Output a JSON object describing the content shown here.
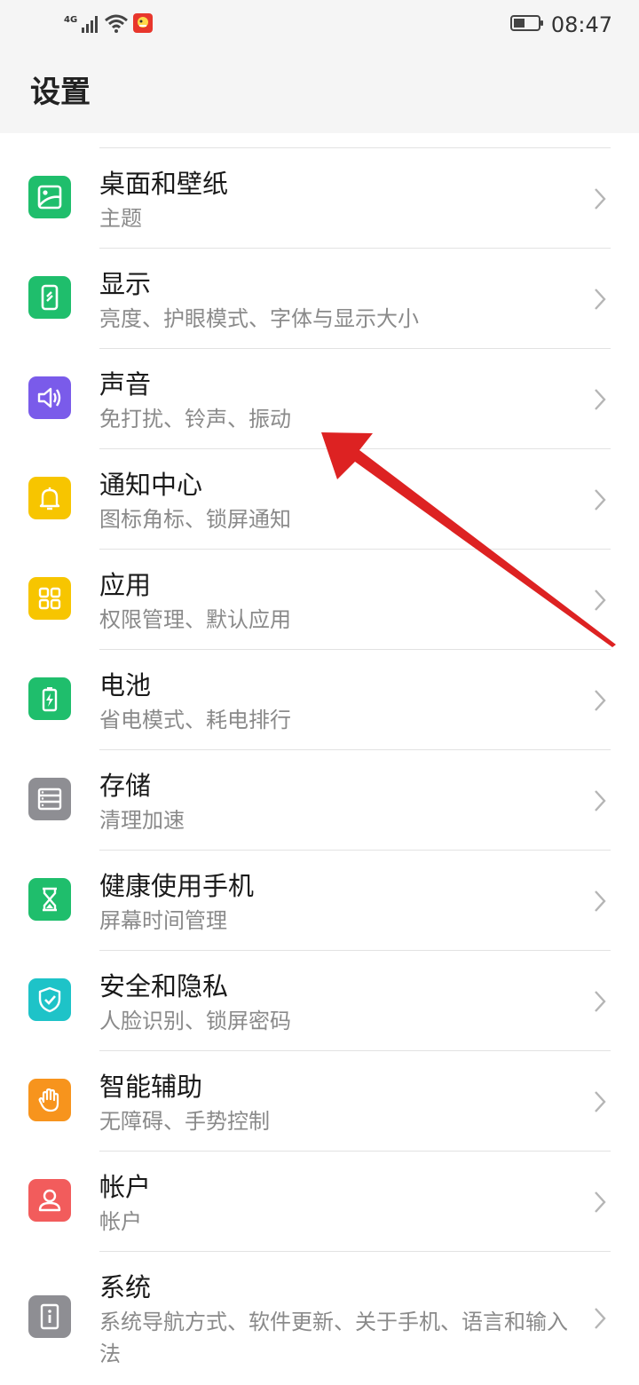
{
  "status_bar": {
    "network": "4G",
    "time": "08:47",
    "icons": [
      "signal-icon",
      "wifi-icon",
      "app-notification-icon",
      "battery-icon"
    ]
  },
  "page": {
    "title": "设置"
  },
  "items": [
    {
      "title": "桌面和壁纸",
      "subtitle": "主题",
      "icon": "wallpaper-icon",
      "color": "#1fbe6c"
    },
    {
      "title": "显示",
      "subtitle": "亮度、护眼模式、字体与显示大小",
      "icon": "display-icon",
      "color": "#1fbe6c"
    },
    {
      "title": "声音",
      "subtitle": "免打扰、铃声、振动",
      "icon": "sound-icon",
      "color": "#7a5bea"
    },
    {
      "title": "通知中心",
      "subtitle": "图标角标、锁屏通知",
      "icon": "bell-icon",
      "color": "#f7c500"
    },
    {
      "title": "应用",
      "subtitle": "权限管理、默认应用",
      "icon": "apps-icon",
      "color": "#f7c500"
    },
    {
      "title": "电池",
      "subtitle": "省电模式、耗电排行",
      "icon": "battery-icon",
      "color": "#1fbe6c"
    },
    {
      "title": "存储",
      "subtitle": "清理加速",
      "icon": "storage-icon",
      "color": "#8e8e93"
    },
    {
      "title": "健康使用手机",
      "subtitle": "屏幕时间管理",
      "icon": "hourglass-icon",
      "color": "#1fbe6c"
    },
    {
      "title": "安全和隐私",
      "subtitle": "人脸识别、锁屏密码",
      "icon": "shield-icon",
      "color": "#1ec3c8"
    },
    {
      "title": "智能辅助",
      "subtitle": "无障碍、手势控制",
      "icon": "hand-icon",
      "color": "#f7941d"
    },
    {
      "title": "帐户",
      "subtitle": "帐户",
      "icon": "account-icon",
      "color": "#f25c5c"
    },
    {
      "title": "系统",
      "subtitle": "系统导航方式、软件更新、关于手机、语言和输入法",
      "icon": "info-icon",
      "color": "#8e8e93"
    }
  ],
  "annotation": {
    "type": "red-arrow",
    "points_to": "声音",
    "color": "#dd2222"
  }
}
